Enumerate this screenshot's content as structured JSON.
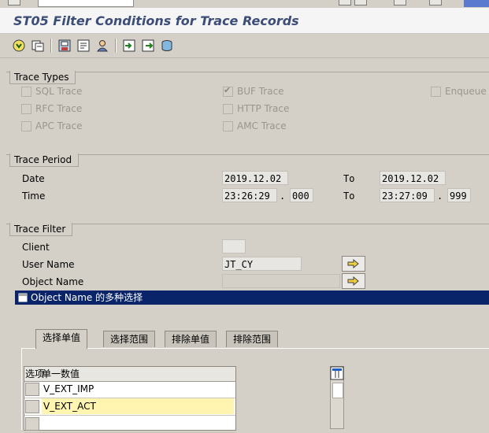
{
  "title": "ST05 Filter Conditions for Trace Records",
  "trace_types": {
    "label": "Trace Types",
    "options": [
      {
        "label": "SQL Trace",
        "checked": false
      },
      {
        "label": "BUF Trace",
        "checked": true
      },
      {
        "label": "Enqueue T",
        "checked": false
      },
      {
        "label": "RFC Trace",
        "checked": false
      },
      {
        "label": "HTTP Trace",
        "checked": false
      },
      {
        "label": "APC Trace",
        "checked": false
      },
      {
        "label": "AMC Trace",
        "checked": false
      }
    ]
  },
  "trace_period": {
    "label": "Trace Period",
    "date_label": "Date",
    "time_label": "Time",
    "to_label": "To",
    "date_from": "2019.12.02",
    "date_to": "2019.12.02",
    "time_from": "23:26:29",
    "time_from_ms": "000",
    "time_to": "23:27:09",
    "time_to_ms": "999",
    "ms_separator": "."
  },
  "trace_filter": {
    "label": "Trace Filter",
    "client_label": "Client",
    "client_value": "",
    "user_label": "User Name",
    "user_value": "JT_CY",
    "object_label": "Object Name",
    "object_value": ""
  },
  "popup": {
    "title": "Object Name 的多种选择",
    "tabs": [
      "选择单值",
      "选择范围",
      "排除单值",
      "排除范围"
    ],
    "active_tab": 0,
    "columns": [
      "选项",
      "单一数值"
    ],
    "rows": [
      "V_EXT_IMP",
      "V_EXT_ACT",
      ""
    ]
  },
  "colors": {
    "title": "#3c4d78",
    "popup_header": "#0a246a",
    "highlight_row": "#fff4b0"
  }
}
